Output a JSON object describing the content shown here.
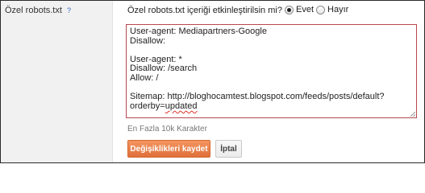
{
  "setting": {
    "label": "Özel robots.txt",
    "help_label": "?",
    "question": "Özel robots.txt içeriği etkinleştirilsin mi?"
  },
  "radio": {
    "yes_label": "Evet",
    "no_label": "Hayır",
    "selected": "yes"
  },
  "editor": {
    "lines": [
      "User-agent: Mediapartners-Google",
      "Disallow:",
      "",
      "User-agent: *",
      "Disallow: /search",
      "Allow: /",
      "",
      "Sitemap: http://bloghocamtest.blogspot.com/feeds/posts/default?",
      "orderby=updated"
    ],
    "underlined_word": "updated",
    "border_color": "#b7484f"
  },
  "hint": "En Fazla 10k Karakter",
  "buttons": {
    "save_label": "Değişiklikleri kaydet",
    "cancel_label": "İptal",
    "save_color": "#e9804a"
  },
  "icons": {
    "resize": "resize-grip-icon"
  }
}
